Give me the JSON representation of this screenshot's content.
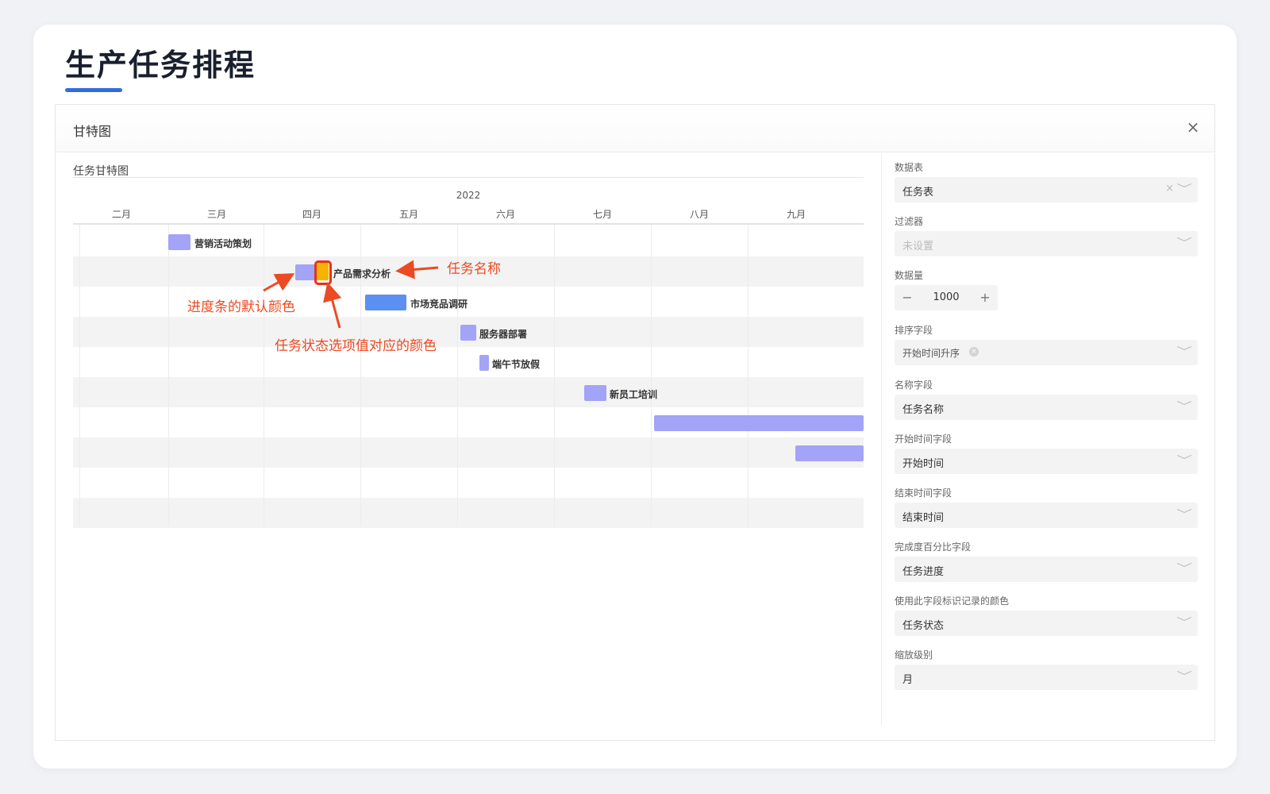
{
  "page": {
    "title": "生产任务排程"
  },
  "modal": {
    "title": "甘特图",
    "close_icon": "×"
  },
  "gantt": {
    "title": "任务甘特图",
    "year": "2022",
    "months": [
      "二月",
      "三月",
      "四月",
      "五月",
      "六月",
      "七月",
      "八月",
      "九月"
    ],
    "tasks": [
      {
        "name": "营销活动策划",
        "color": "#a3a3f7"
      },
      {
        "name": "产品需求分析",
        "color": "#a3a3f7",
        "status_color": "#f4b400"
      },
      {
        "name": "市场竞品调研",
        "color": "#5b8ff1"
      },
      {
        "name": "服务器部署",
        "color": "#a3a3f7"
      },
      {
        "name": "端午节放假",
        "color": "#a3a3f7"
      },
      {
        "name": "新员工培训",
        "color": "#a3a3f7"
      },
      {
        "name": "",
        "color": "#a3a3f7"
      },
      {
        "name": "",
        "color": "#a3a3f7"
      }
    ]
  },
  "annotations": {
    "task_name": "任务名称",
    "progress_default_color": "进度条的默认颜色",
    "status_option_color": "任务状态选项值对应的颜色",
    "color": "#ec4a22"
  },
  "settings": {
    "data_table": {
      "label": "数据表",
      "value": "任务表",
      "clear": "×"
    },
    "filter": {
      "label": "过滤器",
      "placeholder": "未设置"
    },
    "data_count": {
      "label": "数据量",
      "value": "1000",
      "minus": "−",
      "plus": "+"
    },
    "sort_field": {
      "label": "排序字段",
      "value": "开始时间升序",
      "clear": "×"
    },
    "name_field": {
      "label": "名称字段",
      "value": "任务名称"
    },
    "start_field": {
      "label": "开始时间字段",
      "value": "开始时间"
    },
    "end_field": {
      "label": "结束时间字段",
      "value": "结束时间"
    },
    "progress_field": {
      "label": "完成度百分比字段",
      "value": "任务进度"
    },
    "color_field": {
      "label": "使用此字段标识记录的颜色",
      "value": "任务状态"
    },
    "zoom_level": {
      "label": "缩放级别",
      "value": "月"
    },
    "chevron_icon": "﹀"
  }
}
